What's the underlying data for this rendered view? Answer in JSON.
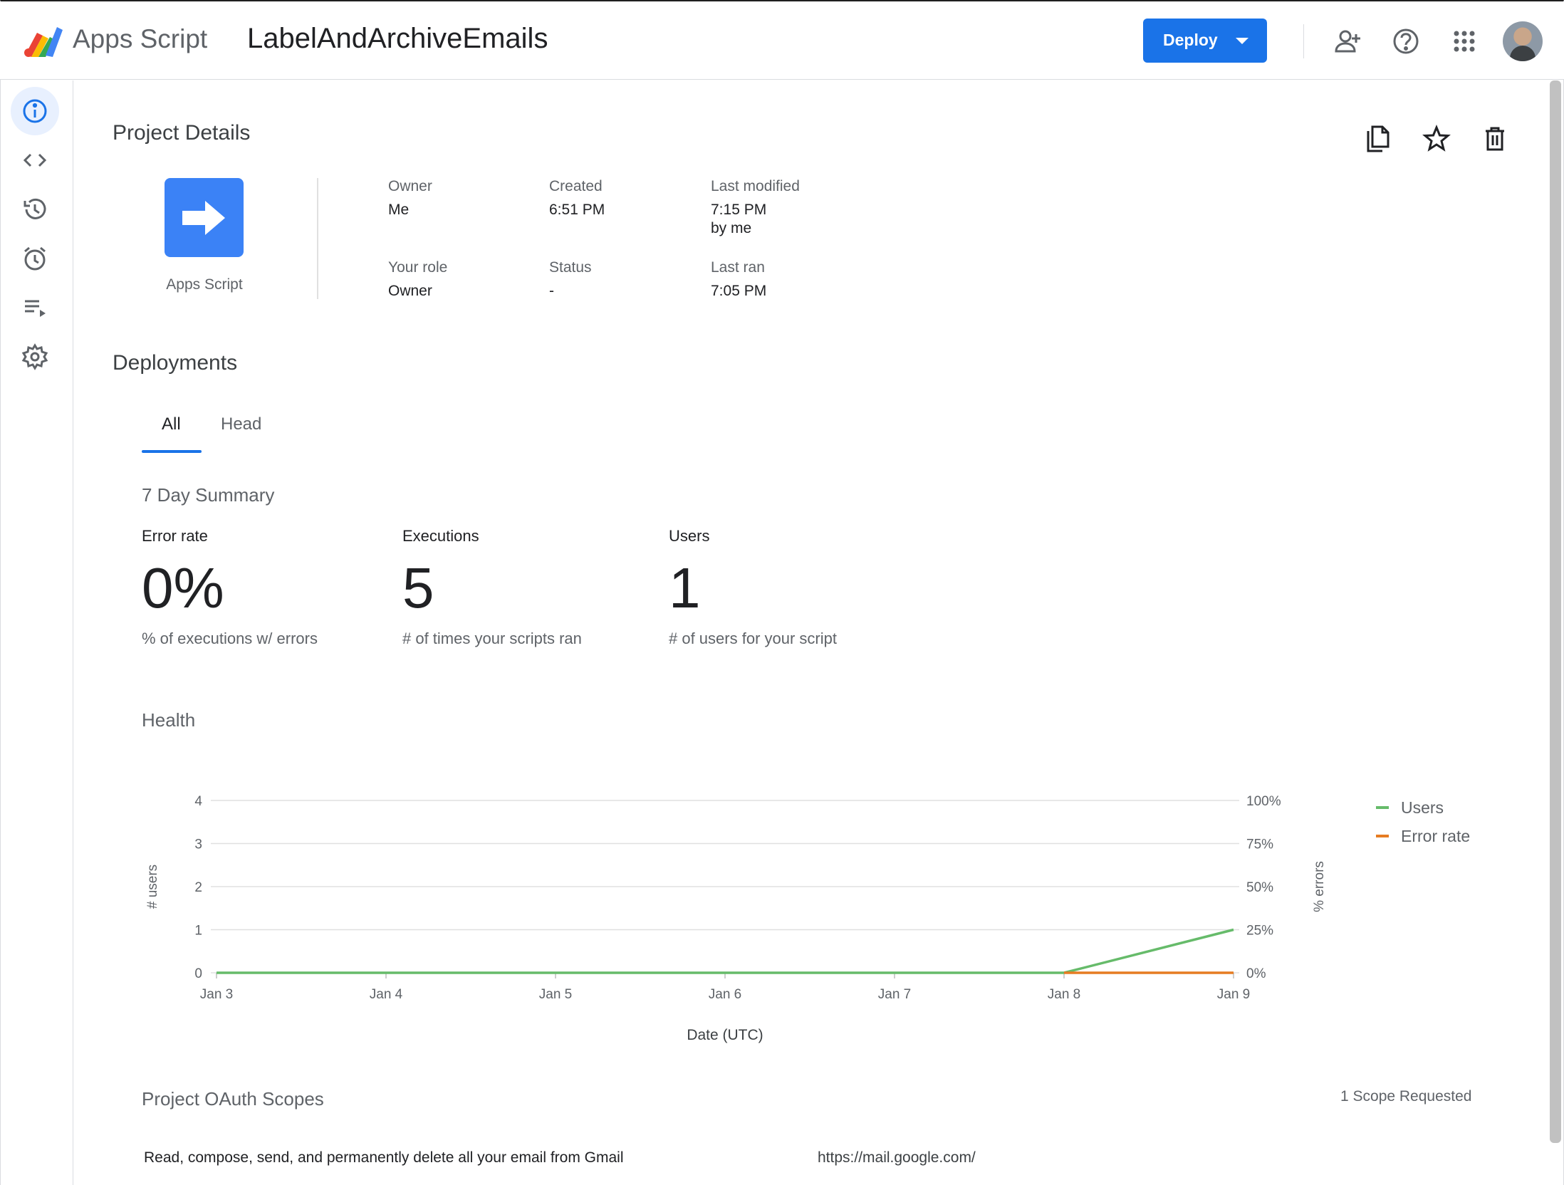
{
  "header": {
    "brand": "Apps Script",
    "project_title": "LabelAndArchiveEmails",
    "deploy_label": "Deploy"
  },
  "icons": {
    "brand_logo": "apps-script-logo",
    "share": "add-person-icon",
    "help": "help-icon",
    "apps": "apps-grid-icon",
    "account": "account-avatar"
  },
  "sidebar": {
    "items": [
      {
        "name": "overview",
        "icon": "info-icon",
        "active": true
      },
      {
        "name": "editor",
        "icon": "code-icon"
      },
      {
        "name": "project-history",
        "icon": "history-icon"
      },
      {
        "name": "triggers",
        "icon": "alarm-icon"
      },
      {
        "name": "executions",
        "icon": "list-play-icon"
      },
      {
        "name": "settings",
        "icon": "gear-icon"
      }
    ]
  },
  "project_details": {
    "heading": "Project Details",
    "app_label": "Apps Script",
    "owner_label": "Owner",
    "owner_value": "Me",
    "created_label": "Created",
    "created_value": "6:51 PM",
    "modified_label": "Last modified",
    "modified_value": "7:15 PM",
    "modified_by": "by me",
    "role_label": "Your role",
    "role_value": "Owner",
    "status_label": "Status",
    "status_value": "-",
    "last_ran_label": "Last ran",
    "last_ran_value": "7:05 PM"
  },
  "deployments": {
    "heading": "Deployments",
    "tabs": [
      "All",
      "Head"
    ],
    "active_tab": "All"
  },
  "summary": {
    "heading": "7 Day Summary",
    "error_rate_label": "Error rate",
    "error_rate_value": "0%",
    "error_rate_desc": "% of executions w/ errors",
    "executions_label": "Executions",
    "executions_value": "5",
    "executions_desc": "# of times your scripts ran",
    "users_label": "Users",
    "users_value": "1",
    "users_desc": "# of users for your script"
  },
  "health": {
    "heading": "Health"
  },
  "chart_data": {
    "type": "line",
    "categories": [
      "Jan 3",
      "Jan 4",
      "Jan 5",
      "Jan 6",
      "Jan 7",
      "Jan 8",
      "Jan 9"
    ],
    "series": [
      {
        "name": "Users",
        "axis": "left",
        "color": "#66bb6a",
        "values": [
          0,
          0,
          0,
          0,
          0,
          0,
          1
        ]
      },
      {
        "name": "Error rate",
        "axis": "right",
        "color": "#e67c22",
        "values": [
          null,
          null,
          null,
          null,
          null,
          0,
          0
        ]
      }
    ],
    "ylabel": "# users",
    "y2label": "% errors",
    "xlabel": "Date (UTC)",
    "ylim": [
      0,
      4
    ],
    "y_ticks": [
      "0",
      "1",
      "2",
      "3",
      "4"
    ],
    "y2lim": [
      0,
      100
    ],
    "y2_ticks": [
      "0%",
      "25%",
      "50%",
      "75%",
      "100%"
    ],
    "grid": true,
    "legend": "right"
  },
  "scopes": {
    "heading": "Project OAuth Scopes",
    "count_label": "1 Scope Requested",
    "items": [
      {
        "description": "Read, compose, send, and permanently delete all your email from Gmail",
        "url": "https://mail.google.com/"
      }
    ]
  },
  "colors": {
    "accent": "#1a73e8",
    "users_line": "#66bb6a",
    "error_line": "#e67c22"
  }
}
